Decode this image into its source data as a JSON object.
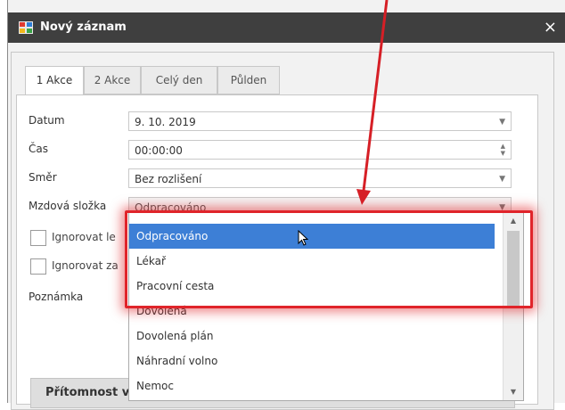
{
  "window": {
    "title": "Nový záznam",
    "close_symbol": "×"
  },
  "tabs": [
    {
      "label": "1 Akce",
      "active": true
    },
    {
      "label": "2 Akce",
      "active": false
    },
    {
      "label": "Celý den",
      "active": false
    },
    {
      "label": "Půlden",
      "active": false
    }
  ],
  "form": {
    "datum": {
      "label": "Datum",
      "value": "9. 10. 2019"
    },
    "cas": {
      "label": "Čas",
      "value": "00:00:00"
    },
    "smer": {
      "label": "Směr",
      "value": "Bez rozlišení"
    },
    "mzdova_slozka": {
      "label": "Mzdová složka",
      "value": "Odpracováno"
    },
    "ignore1_label": "Ignorovat le",
    "ignore2_label": "Ignorovat za",
    "poznamka_label": "Poznámka"
  },
  "dropdown": {
    "selected": "Odpracováno",
    "items": [
      "Odpracováno",
      "Lékař",
      "Pracovní cesta",
      "Dovolená",
      "Dovolená plán",
      "Náhradní volno",
      "Nemoc"
    ]
  },
  "bottom_section_label": "Přítomnost v zóně",
  "colors": {
    "highlight": "#e0242a",
    "selection": "#3d7fd6",
    "titlebar": "#3f3f3f"
  }
}
